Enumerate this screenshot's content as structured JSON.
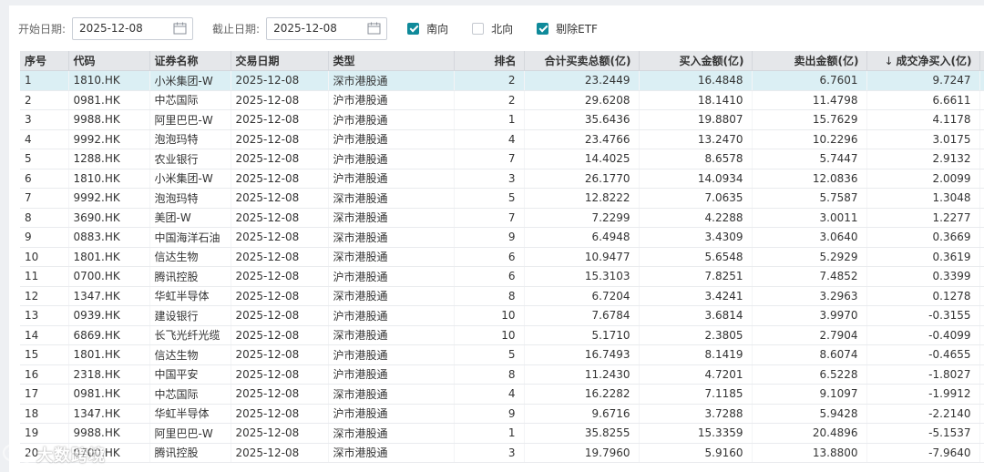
{
  "filters": {
    "start_label": "开始日期:",
    "start_value": "2025-12-08",
    "end_label": "截止日期:",
    "end_value": "2025-12-08",
    "southbound": {
      "label": "南向",
      "checked": true
    },
    "northbound": {
      "label": "北向",
      "checked": false
    },
    "exclude_etf": {
      "label": "剔除ETF",
      "checked": true
    }
  },
  "table": {
    "columns": {
      "idx": "序号",
      "code": "代码",
      "name": "证券名称",
      "date": "交易日期",
      "type": "类型",
      "rank": "排名",
      "total": "合计买卖总额(亿)",
      "buy": "买入金额(亿)",
      "sell": "卖出金额(亿)",
      "sort_arrow": "↓",
      "net": "成交净买入(亿)"
    },
    "rows": [
      {
        "idx": "1",
        "code": "1810.HK",
        "name": "小米集团-W",
        "date": "2025-12-08",
        "type": "深市港股通",
        "rank": "2",
        "total": "23.2449",
        "buy": "16.4848",
        "sell": "6.7601",
        "net": "9.7247"
      },
      {
        "idx": "2",
        "code": "0981.HK",
        "name": "中芯国际",
        "date": "2025-12-08",
        "type": "沪市港股通",
        "rank": "2",
        "total": "29.6208",
        "buy": "18.1410",
        "sell": "11.4798",
        "net": "6.6611"
      },
      {
        "idx": "3",
        "code": "9988.HK",
        "name": "阿里巴巴-W",
        "date": "2025-12-08",
        "type": "沪市港股通",
        "rank": "1",
        "total": "35.6436",
        "buy": "19.8807",
        "sell": "15.7629",
        "net": "4.1178"
      },
      {
        "idx": "4",
        "code": "9992.HK",
        "name": "泡泡玛特",
        "date": "2025-12-08",
        "type": "沪市港股通",
        "rank": "4",
        "total": "23.4766",
        "buy": "13.2470",
        "sell": "10.2296",
        "net": "3.0175"
      },
      {
        "idx": "5",
        "code": "1288.HK",
        "name": "农业银行",
        "date": "2025-12-08",
        "type": "沪市港股通",
        "rank": "7",
        "total": "14.4025",
        "buy": "8.6578",
        "sell": "5.7447",
        "net": "2.9132"
      },
      {
        "idx": "6",
        "code": "1810.HK",
        "name": "小米集团-W",
        "date": "2025-12-08",
        "type": "沪市港股通",
        "rank": "3",
        "total": "26.1770",
        "buy": "14.0934",
        "sell": "12.0836",
        "net": "2.0099"
      },
      {
        "idx": "7",
        "code": "9992.HK",
        "name": "泡泡玛特",
        "date": "2025-12-08",
        "type": "深市港股通",
        "rank": "5",
        "total": "12.8222",
        "buy": "7.0635",
        "sell": "5.7587",
        "net": "1.3048"
      },
      {
        "idx": "8",
        "code": "3690.HK",
        "name": "美团-W",
        "date": "2025-12-08",
        "type": "深市港股通",
        "rank": "7",
        "total": "7.2299",
        "buy": "4.2288",
        "sell": "3.0011",
        "net": "1.2277"
      },
      {
        "idx": "9",
        "code": "0883.HK",
        "name": "中国海洋石油",
        "date": "2025-12-08",
        "type": "深市港股通",
        "rank": "9",
        "total": "6.4948",
        "buy": "3.4309",
        "sell": "3.0640",
        "net": "0.3669"
      },
      {
        "idx": "10",
        "code": "1801.HK",
        "name": "信达生物",
        "date": "2025-12-08",
        "type": "深市港股通",
        "rank": "6",
        "total": "10.9477",
        "buy": "5.6548",
        "sell": "5.2929",
        "net": "0.3619"
      },
      {
        "idx": "11",
        "code": "0700.HK",
        "name": "腾讯控股",
        "date": "2025-12-08",
        "type": "沪市港股通",
        "rank": "6",
        "total": "15.3103",
        "buy": "7.8251",
        "sell": "7.4852",
        "net": "0.3399"
      },
      {
        "idx": "12",
        "code": "1347.HK",
        "name": "华虹半导体",
        "date": "2025-12-08",
        "type": "深市港股通",
        "rank": "8",
        "total": "6.7204",
        "buy": "3.4241",
        "sell": "3.2963",
        "net": "0.1278"
      },
      {
        "idx": "13",
        "code": "0939.HK",
        "name": "建设银行",
        "date": "2025-12-08",
        "type": "沪市港股通",
        "rank": "10",
        "total": "7.6784",
        "buy": "3.6814",
        "sell": "3.9970",
        "net": "-0.3155"
      },
      {
        "idx": "14",
        "code": "6869.HK",
        "name": "长飞光纤光缆",
        "date": "2025-12-08",
        "type": "深市港股通",
        "rank": "10",
        "total": "5.1710",
        "buy": "2.3805",
        "sell": "2.7904",
        "net": "-0.4099"
      },
      {
        "idx": "15",
        "code": "1801.HK",
        "name": "信达生物",
        "date": "2025-12-08",
        "type": "沪市港股通",
        "rank": "5",
        "total": "16.7493",
        "buy": "8.1419",
        "sell": "8.6074",
        "net": "-0.4655"
      },
      {
        "idx": "16",
        "code": "2318.HK",
        "name": "中国平安",
        "date": "2025-12-08",
        "type": "沪市港股通",
        "rank": "8",
        "total": "11.2430",
        "buy": "4.7201",
        "sell": "6.5228",
        "net": "-1.8027"
      },
      {
        "idx": "17",
        "code": "0981.HK",
        "name": "中芯国际",
        "date": "2025-12-08",
        "type": "深市港股通",
        "rank": "4",
        "total": "16.2282",
        "buy": "7.1185",
        "sell": "9.1097",
        "net": "-1.9912"
      },
      {
        "idx": "18",
        "code": "1347.HK",
        "name": "华虹半导体",
        "date": "2025-12-08",
        "type": "沪市港股通",
        "rank": "9",
        "total": "9.6716",
        "buy": "3.7288",
        "sell": "5.9428",
        "net": "-2.2140"
      },
      {
        "idx": "19",
        "code": "9988.HK",
        "name": "阿里巴巴-W",
        "date": "2025-12-08",
        "type": "深市港股通",
        "rank": "1",
        "total": "35.8255",
        "buy": "15.3359",
        "sell": "20.4896",
        "net": "-5.1537"
      },
      {
        "idx": "20",
        "code": "0700.HK",
        "name": "腾讯控股",
        "date": "2025-12-08",
        "type": "深市港股通",
        "rank": "3",
        "total": "19.7960",
        "buy": "5.9160",
        "sell": "13.8800",
        "net": "-7.9640"
      }
    ]
  },
  "watermark": {
    "text": "大数跨境"
  },
  "colors": {
    "accent": "#0f8a9a",
    "header_bg": "#e5e7ea",
    "selected_row": "#dbeff4"
  },
  "icons": {
    "date_picker": "calendar-icon",
    "checkbox": "check-icon",
    "sort": "sort-desc-arrow"
  }
}
